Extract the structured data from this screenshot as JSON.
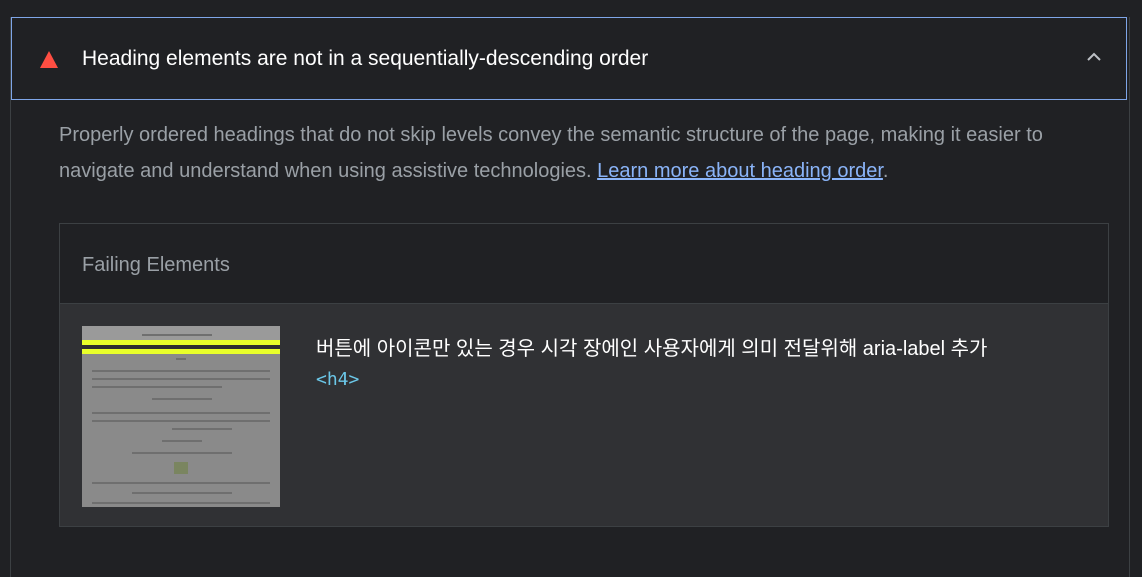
{
  "audit": {
    "title": "Heading elements are not in a sequentially-descending order",
    "description_text": "Properly ordered headings that do not skip levels convey the semantic structure of the page, making it easier to navigate and understand when using assistive technologies. ",
    "learn_more_link": "Learn more about heading order",
    "description_end": ".",
    "status_icon": "fail-triangle-icon",
    "status_color": "#ff4e42",
    "expand_icon": "chevron-up-icon"
  },
  "details": {
    "title": "Failing Elements",
    "items": [
      {
        "label": "버튼에 아이콘만 있는 경우 시각 장에인 사용자에게 의미 전달위해 aria-label 추가",
        "tag": "<h4>",
        "thumbnail_icon": "page-screenshot-thumbnail"
      }
    ]
  },
  "colors": {
    "background": "#202124",
    "row_background": "#303134",
    "accent_border": "#7fa6e8",
    "link": "#8ab4f8",
    "tag": "#6bc7e8"
  }
}
